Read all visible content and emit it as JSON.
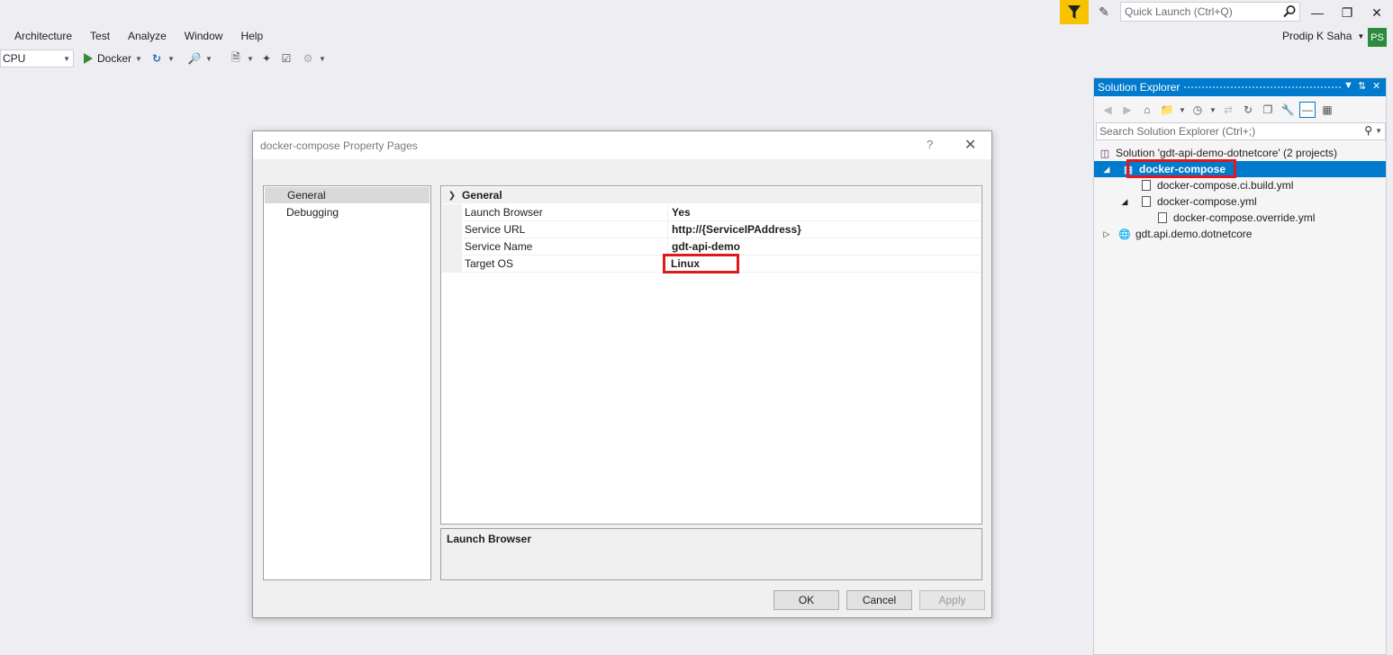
{
  "titlebar": {
    "quick_launch_placeholder": "Quick Launch (Ctrl+Q)",
    "user_name": "Prodip K Saha",
    "user_initials": "PS"
  },
  "menu": {
    "items": [
      "Architecture",
      "Test",
      "Analyze",
      "Window",
      "Help"
    ]
  },
  "toolbar": {
    "platform_value": "CPU",
    "run_target": "Docker"
  },
  "dialog": {
    "title": "docker-compose Property Pages",
    "help_symbol": "?",
    "nav_items": [
      "General",
      "Debugging"
    ],
    "section": "General",
    "properties": [
      {
        "name": "Launch Browser",
        "value": "Yes"
      },
      {
        "name": "Service URL",
        "value": "http://{ServiceIPAddress}"
      },
      {
        "name": "Service Name",
        "value": "gdt-api-demo"
      },
      {
        "name": "Target OS",
        "value": "Linux"
      }
    ],
    "description_title": "Launch Browser",
    "buttons": {
      "ok": "OK",
      "cancel": "Cancel",
      "apply": "Apply"
    }
  },
  "solution_explorer": {
    "title": "Solution Explorer",
    "search_placeholder": "Search Solution Explorer (Ctrl+;)",
    "tree": [
      {
        "label": "Solution 'gdt-api-demo-dotnetcore' (2 projects)"
      },
      {
        "label": "docker-compose"
      },
      {
        "label": "docker-compose.ci.build.yml"
      },
      {
        "label": "docker-compose.yml"
      },
      {
        "label": "docker-compose.override.yml"
      },
      {
        "label": "gdt.api.demo.dotnetcore"
      }
    ]
  },
  "colors": {
    "accent": "#007acc",
    "highlight_box": "#e0191f",
    "filter_button": "#f7c200",
    "avatar": "#2d8a3e"
  }
}
